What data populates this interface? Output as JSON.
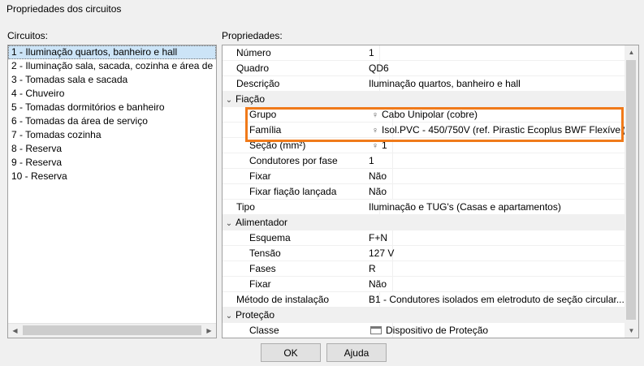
{
  "window": {
    "title": "Propriedades dos circuitos"
  },
  "circuits": {
    "label": "Circuitos:",
    "items": [
      "1 - Iluminação quartos, banheiro e hall",
      "2 - Iluminação sala, sacada, cozinha e área de se",
      "3 - Tomadas sala e sacada",
      "4 - Chuveiro",
      "5 - Tomadas dormitórios e banheiro",
      "6 - Tomadas da área de serviço",
      "7 - Tomadas cozinha",
      "8 - Reserva",
      "9 - Reserva",
      "10 - Reserva"
    ],
    "selected_index": 0
  },
  "properties": {
    "label": "Propriedades:",
    "rows": [
      {
        "name": "Número",
        "value": "1"
      },
      {
        "name": "Quadro",
        "value": "QD6"
      },
      {
        "name": "Descrição",
        "value": "Iluminação quartos, banheiro e hall"
      },
      {
        "category": "Fiação"
      },
      {
        "name": "Grupo",
        "value": "Cabo Unipolar (cobre)",
        "icon": "lightbulb-icon",
        "child": true
      },
      {
        "name": "Família",
        "value": "Isol.PVC - 450/750V (ref. Pirastic Ecoplus BWF Flexível)",
        "icon": "lightbulb-icon",
        "child": true
      },
      {
        "name": "Seção (mm²)",
        "value": "1",
        "icon": "lightbulb-icon",
        "child": true
      },
      {
        "name": "Condutores por fase",
        "value": "1",
        "child": true
      },
      {
        "name": "Fixar",
        "value": "Não",
        "child": true
      },
      {
        "name": "Fixar fiação lançada",
        "value": "Não",
        "child": true
      },
      {
        "name": "Tipo",
        "value": "Iluminação e TUG's (Casas e apartamentos)"
      },
      {
        "category": "Alimentador"
      },
      {
        "name": "Esquema",
        "value": "F+N",
        "child": true
      },
      {
        "name": "Tensão",
        "value": "127 V",
        "child": true
      },
      {
        "name": "Fases",
        "value": "R",
        "child": true
      },
      {
        "name": "Fixar",
        "value": "Não",
        "child": true
      },
      {
        "name": "Método de instalação",
        "value": "B1 - Condutores isolados em eletroduto de seção circular..."
      },
      {
        "category": "Proteção"
      },
      {
        "name": "Classe",
        "value": "Dispositivo de Proteção",
        "icon": "folder-icon",
        "child": true
      }
    ]
  },
  "buttons": {
    "ok": "OK",
    "help": "Ajuda"
  },
  "colors": {
    "highlight": "#f07a1a",
    "selection": "#cce4f7"
  }
}
